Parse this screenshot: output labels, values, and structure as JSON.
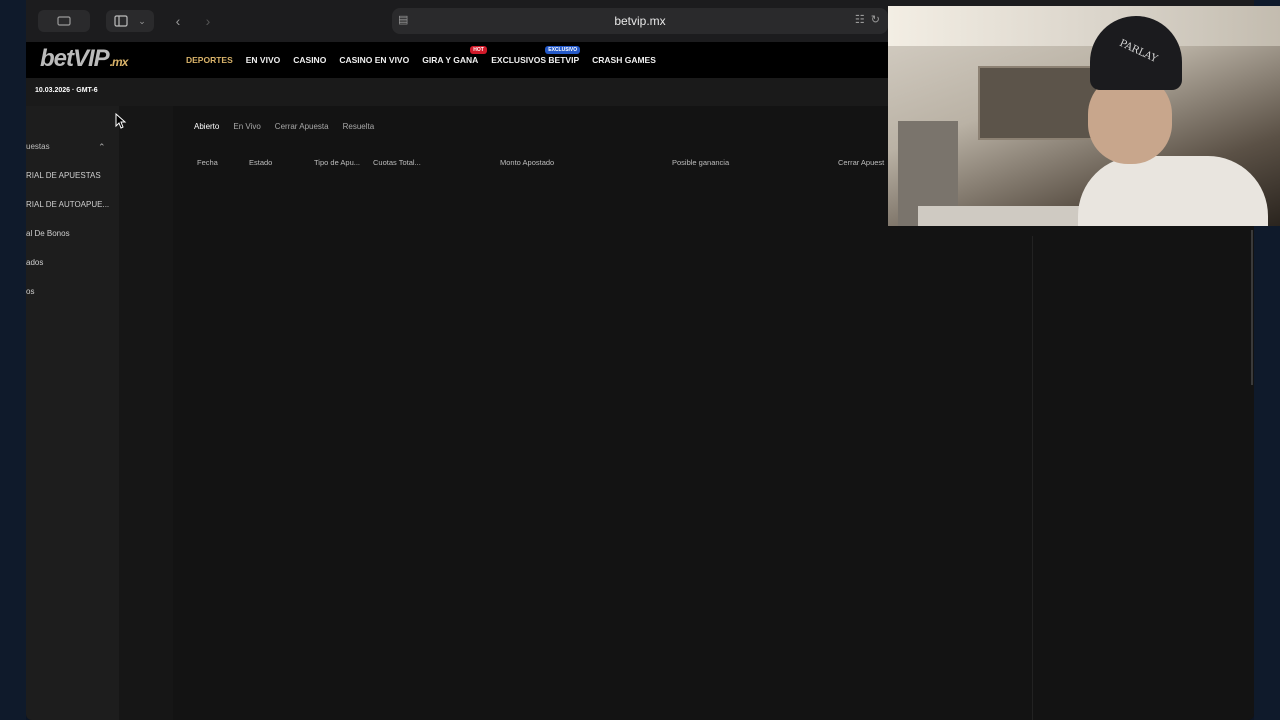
{
  "browser": {
    "url": "betvip.mx"
  },
  "site": {
    "logo": "betVIP",
    "logo_suffix": ".mx",
    "nav": [
      {
        "label": "DEPORTES",
        "active": true
      },
      {
        "label": "EN VIVO"
      },
      {
        "label": "CASINO"
      },
      {
        "label": "CASINO EN VIVO"
      },
      {
        "label": "GIRA Y GANA",
        "badge": "HOT"
      },
      {
        "label": "EXCLUSIVOS BETVIP",
        "badge": "EXCLUSIVO"
      },
      {
        "label": "CRASH GAMES"
      }
    ],
    "datetime": "10.03.2026 · GMT-6"
  },
  "sidebar": {
    "section": "uestas",
    "items": [
      {
        "label": "RIAL DE APUESTAS"
      },
      {
        "label": "RIAL DE AUTOAPUE..."
      },
      {
        "label": "al De Bonos"
      },
      {
        "label": "ados"
      },
      {
        "label": "os"
      }
    ]
  },
  "main": {
    "tabs": [
      {
        "label": "Abierto",
        "active": true
      },
      {
        "label": "En Vivo"
      },
      {
        "label": "Cerrar Apuesta"
      },
      {
        "label": "Resuelta"
      }
    ],
    "columns": [
      "Fecha",
      "Estado",
      "Tipo de Apu...",
      "Cuotas Total...",
      "Monto Apostado",
      "Posible ganancia",
      "Cerrar Apuest"
    ]
  },
  "webcam": {
    "hat_text": "PARLAY"
  },
  "colors": {
    "accent": "#d9b36a",
    "hot_badge": "#d11a2a",
    "exclusive_badge": "#2459c8"
  }
}
